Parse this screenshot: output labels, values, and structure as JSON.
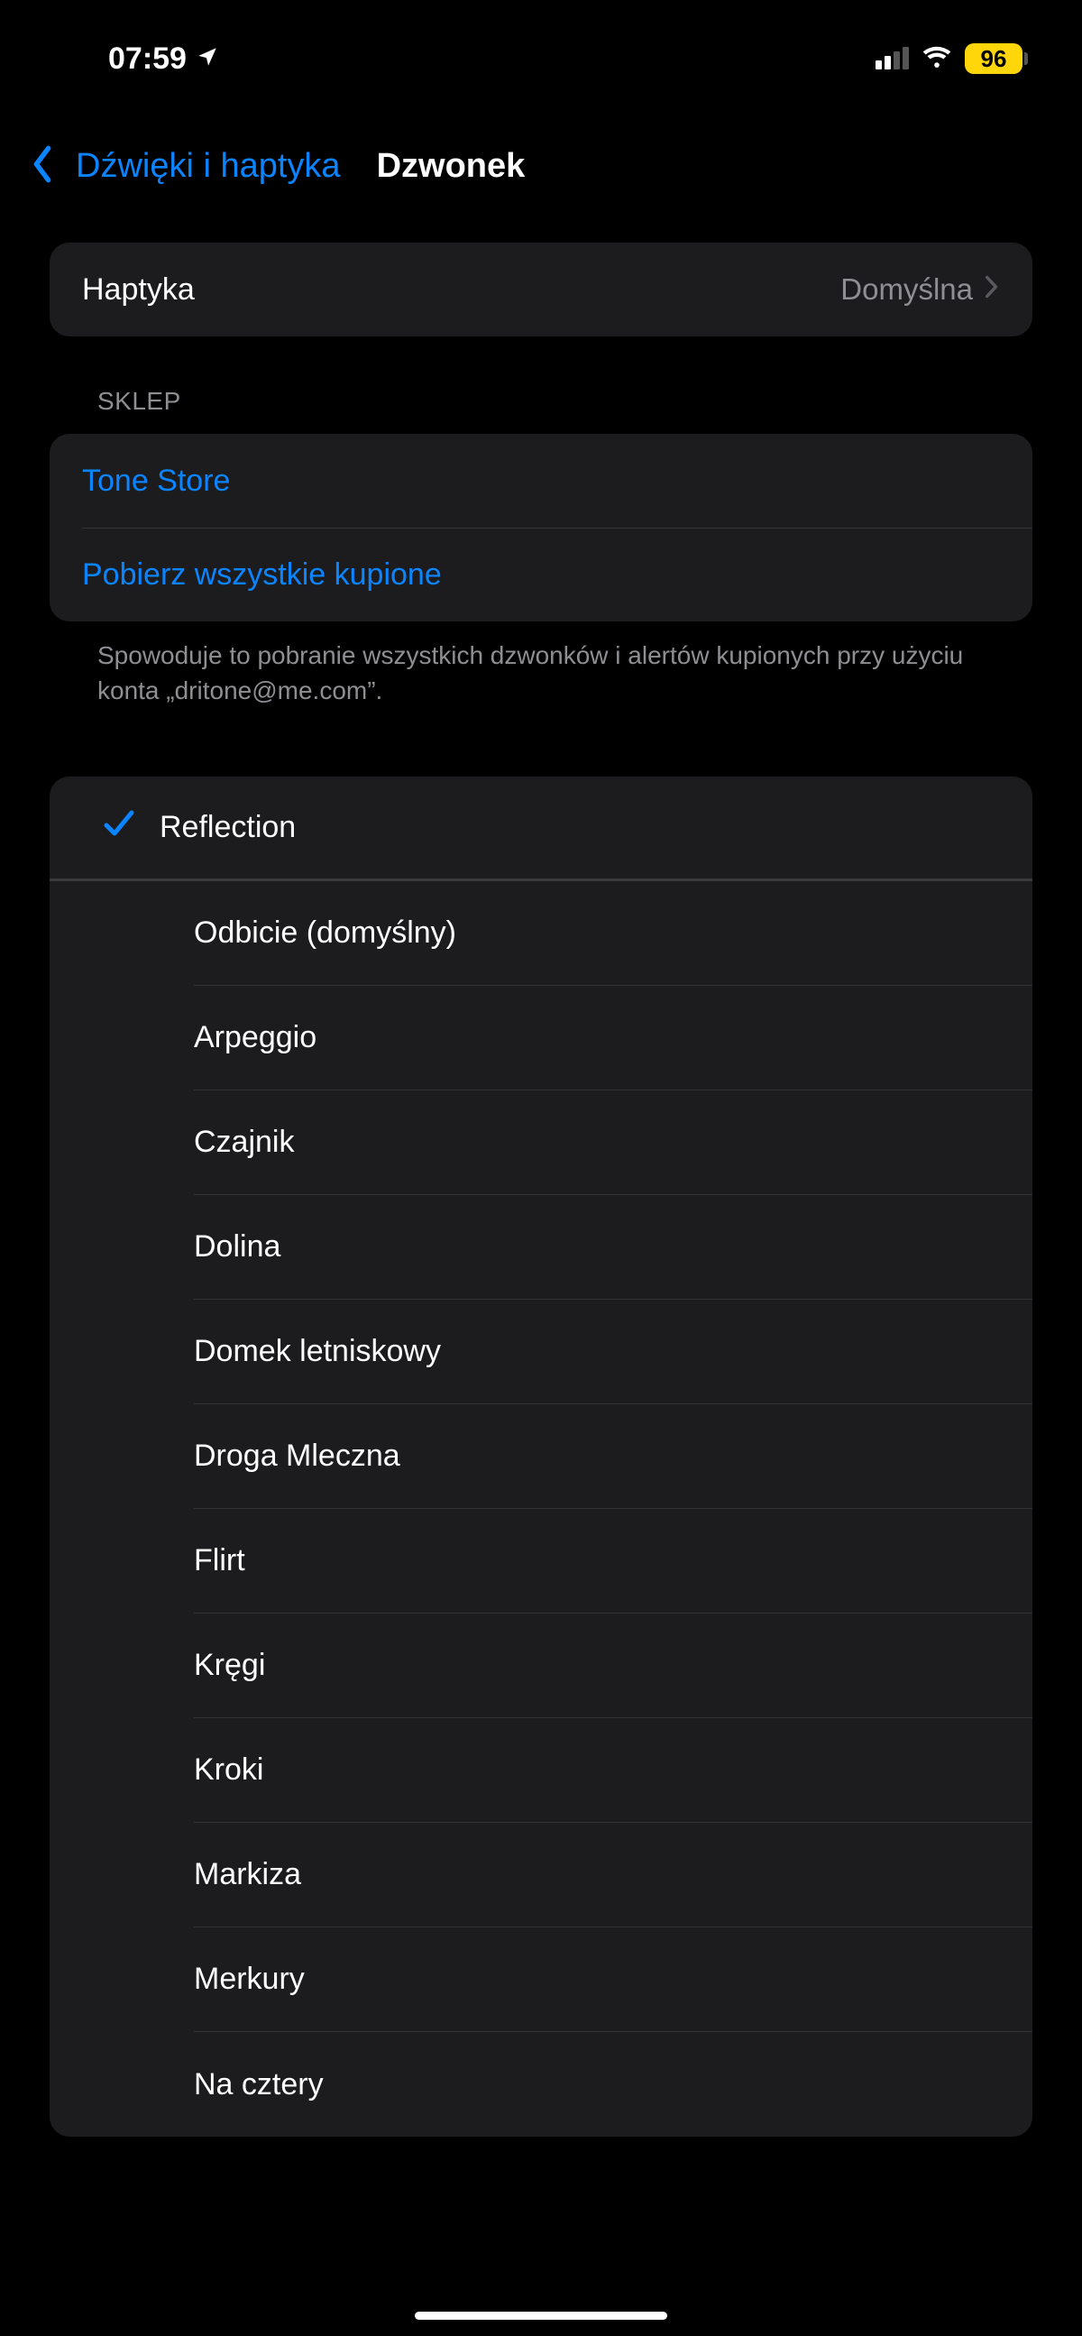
{
  "statusbar": {
    "time": "07:59",
    "battery": "96"
  },
  "nav": {
    "back_label": "Dźwięki i haptyka",
    "title": "Dzwonek"
  },
  "haptics": {
    "label": "Haptyka",
    "value": "Domyślna"
  },
  "store": {
    "header": "SKLEP",
    "tone_store": "Tone Store",
    "download_all": "Pobierz wszystkie kupione",
    "footer": "Spowoduje to pobranie wszystkich dzwonków i alertów kupionych przy użyciu konta „dritone@me.com”."
  },
  "ringtones": {
    "selected": "Reflection",
    "items": [
      "Odbicie (domyślny)",
      "Arpeggio",
      "Czajnik",
      "Dolina",
      "Domek letniskowy",
      "Droga Mleczna",
      "Flirt",
      "Kręgi",
      "Kroki",
      "Markiza",
      "Merkury",
      "Na cztery"
    ]
  }
}
